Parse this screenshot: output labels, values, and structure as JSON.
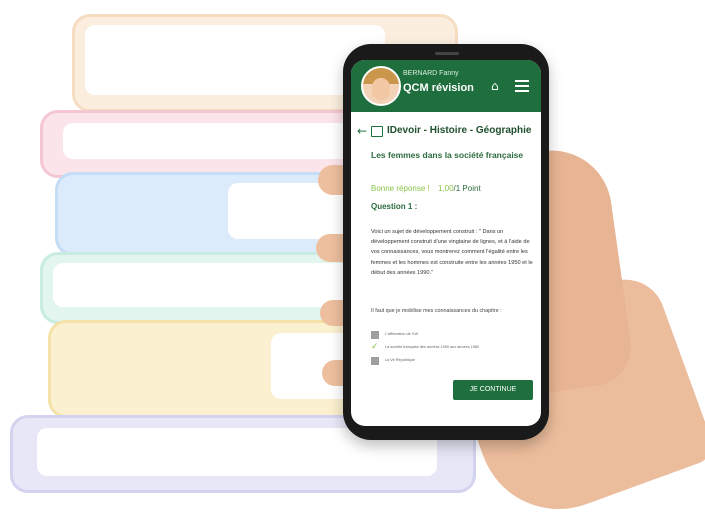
{
  "header": {
    "user_name": "BERNARD Fanny",
    "app_title": "QCM révision",
    "home_icon": "home-icon",
    "menu_icon": "hamburger-menu-icon"
  },
  "nav": {
    "back_icon": "arrow-left-icon",
    "list_icon": "list-icon",
    "title": "IDevoir - Histoire - Géographie"
  },
  "subject": "Les femmes dans la société française",
  "feedback": {
    "status": "Bonne réponse !",
    "score": "1,00",
    "points": "/1 Point"
  },
  "question": {
    "label": "Question 1 :",
    "text": "Voici un sujet de développement construit : \" Dans un développement construit d'une vingtaine de lignes, et à l'aide de vos connaissances, vous montrerez comment l'égalité entre les femmes et les hommes est construite entre les années 1950 et le début des années 1990.\"",
    "prompt": "Il faut que je mobilise mes connaissances du chapitre :"
  },
  "options": [
    {
      "label": "L'affirmation de l'UE",
      "checked": false
    },
    {
      "label": "La société française des années 1950 aux années 1980",
      "checked": true
    },
    {
      "label": "La Ve République",
      "checked": false
    }
  ],
  "continue_label": "JE CONTINUE",
  "colors": {
    "primary": "#1f6f3e",
    "correct": "#8bc34a"
  }
}
